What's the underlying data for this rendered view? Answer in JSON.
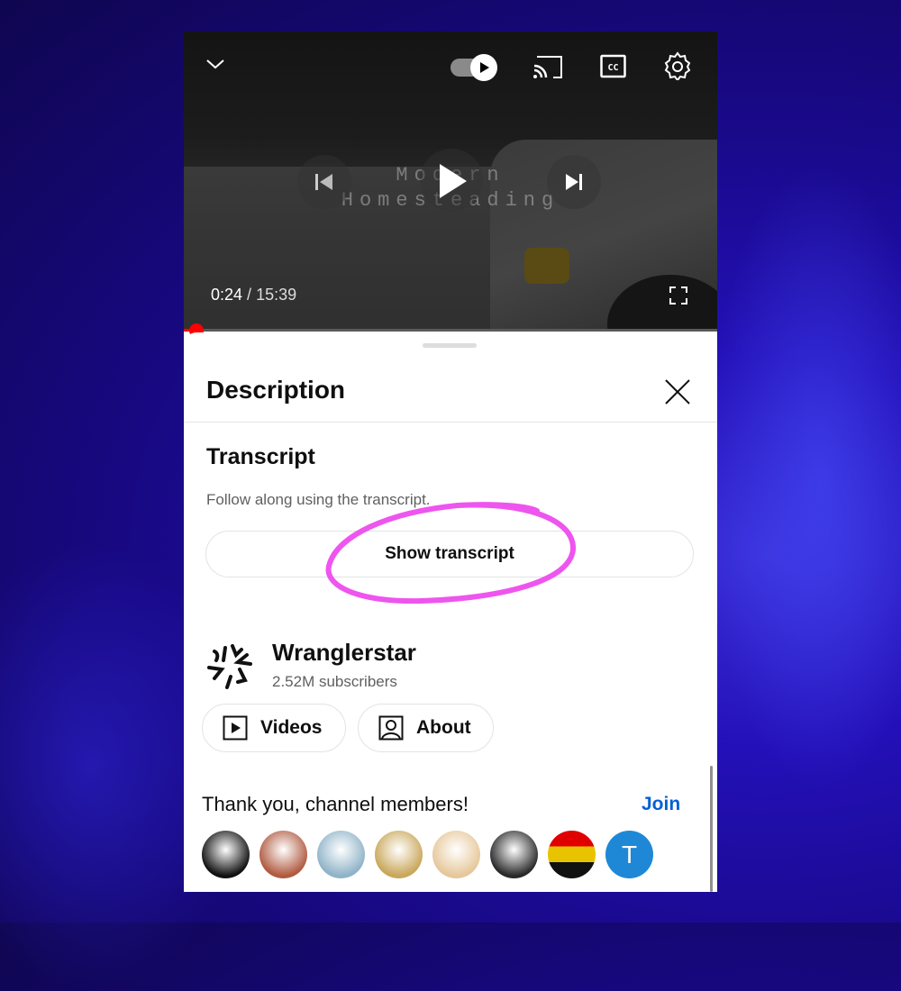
{
  "player": {
    "watermark_line1": "Modern",
    "watermark_line2": "Homesteading",
    "current_time": "0:24",
    "separator": " / ",
    "duration": "15:39",
    "progress_fraction": 0.026,
    "autoplay_on": true,
    "icons": [
      "chevron-down-icon",
      "autoplay-toggle",
      "cast-icon",
      "cc-icon",
      "settings-icon",
      "previous-icon",
      "play-icon",
      "next-icon",
      "fullscreen-icon"
    ]
  },
  "sheet": {
    "title": "Description",
    "transcript": {
      "heading": "Transcript",
      "subtitle": "Follow along using the transcript.",
      "button_label": "Show transcript"
    },
    "channel": {
      "name": "Wranglerstar",
      "subscribers": "2.52M subscribers",
      "videos_label": "Videos",
      "about_label": "About"
    },
    "members": {
      "heading": "Thank you, channel members!",
      "join_label": "Join",
      "avatars": [
        {
          "name": "member-avatar-1",
          "bg": "#111111",
          "letter": ""
        },
        {
          "name": "member-avatar-2",
          "bg": "#b05a40",
          "letter": ""
        },
        {
          "name": "member-avatar-3",
          "bg": "#8fb3c8",
          "letter": ""
        },
        {
          "name": "member-avatar-4",
          "bg": "#c9a75a",
          "letter": ""
        },
        {
          "name": "member-avatar-5",
          "bg": "#e6c79a",
          "letter": ""
        },
        {
          "name": "member-avatar-6",
          "bg": "#2a2a2a",
          "letter": ""
        },
        {
          "name": "member-avatar-7",
          "bg": "#e00000",
          "letter": ""
        },
        {
          "name": "member-avatar-8",
          "bg": "#1e88d6",
          "letter": "T"
        }
      ]
    }
  },
  "colors": {
    "accent_red": "#ff0000",
    "link_blue": "#065fd4",
    "annotation_magenta": "#ee55ee"
  }
}
